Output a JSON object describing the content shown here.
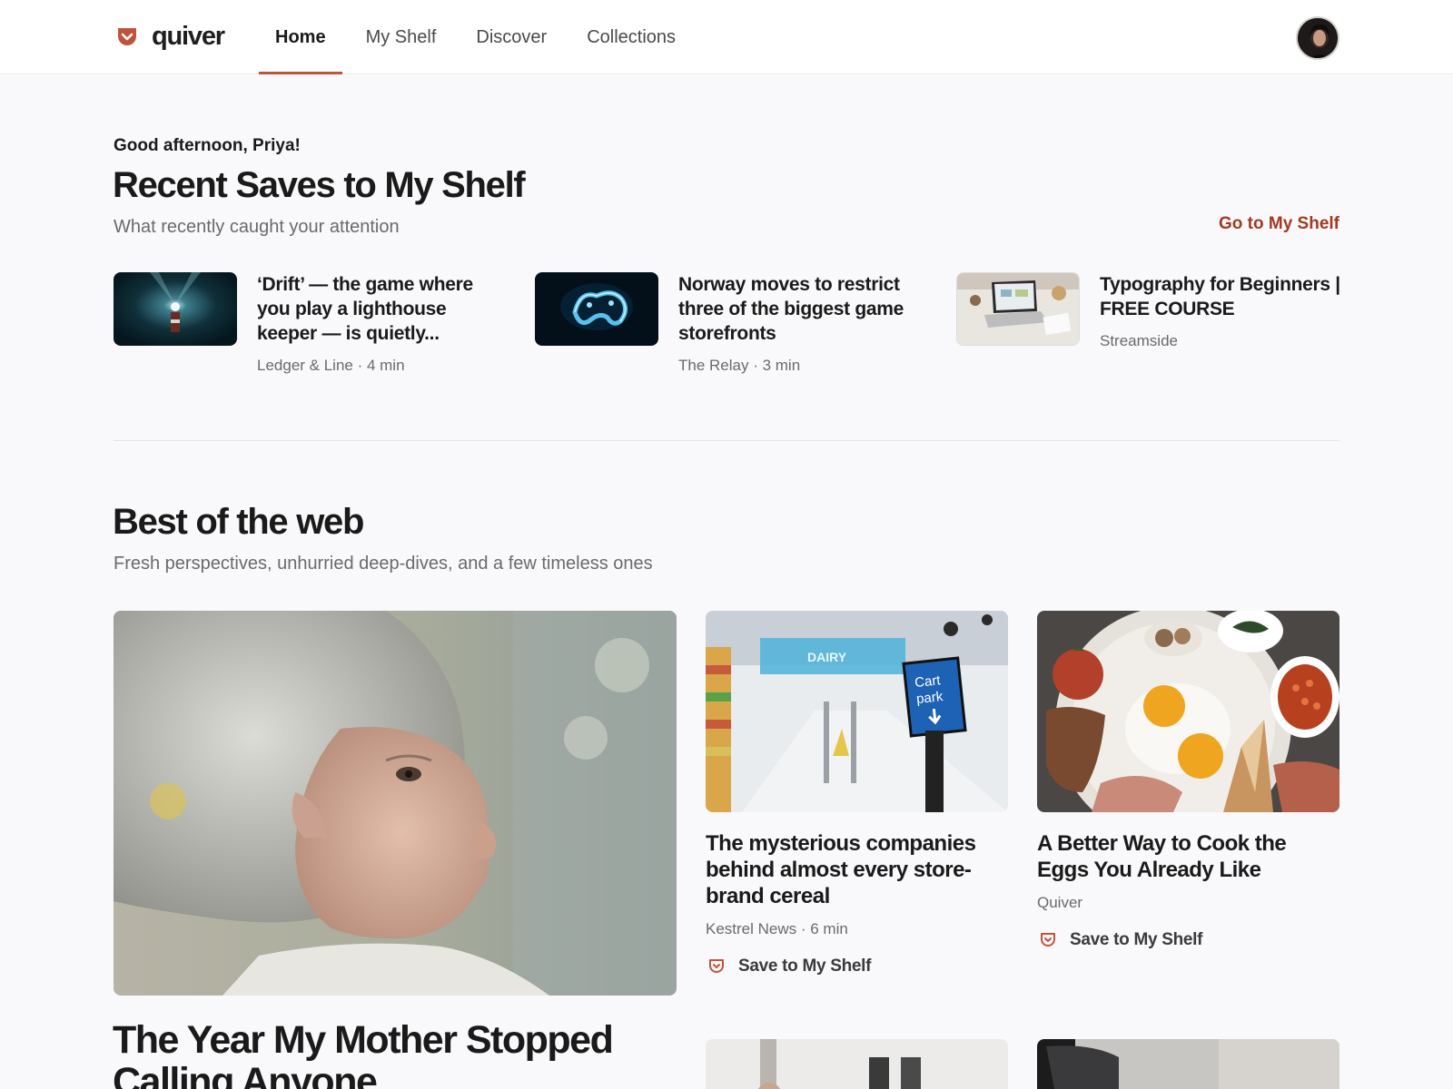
{
  "brand": {
    "name": "quiver",
    "accent": "#c2533b"
  },
  "nav": {
    "tabs": [
      {
        "label": "Home",
        "active": true
      },
      {
        "label": "My Shelf",
        "active": false
      },
      {
        "label": "Discover",
        "active": false
      },
      {
        "label": "Collections",
        "active": false
      }
    ]
  },
  "recent": {
    "greeting": "Good afternoon, Priya!",
    "title": "Recent Saves to My Shelf",
    "subtitle": "What recently caught your attention",
    "link": "Go to My Shelf",
    "items": [
      {
        "title": "‘Drift’ — the game where you play a lighthouse keeper — is quietly...",
        "meta": "Ledger & Line · 4 min"
      },
      {
        "title": "Norway moves to restrict three of the biggest game storefronts",
        "meta": "The Relay · 3 min"
      },
      {
        "title": "Typography for Beginners | FREE COURSE",
        "meta": "Streamside"
      }
    ]
  },
  "best": {
    "title": "Best of the web",
    "subtitle": "Fresh perspectives, unhurried deep-dives, and a few timeless ones",
    "hero": {
      "title": "The Year My Mother Stopped Calling Anyone"
    },
    "cards": [
      {
        "title": "The mysterious companies behind almost every store-brand cereal",
        "meta": "Kestrel News · 6 min",
        "save_label": "Save to My Shelf",
        "sign_text_1": "Cart",
        "sign_text_2": "park",
        "store_sign": "DAIRY"
      },
      {
        "title": "A Better Way to Cook the Eggs You Already Like",
        "meta": "Quiver",
        "save_label": "Save to My Shelf"
      }
    ]
  }
}
